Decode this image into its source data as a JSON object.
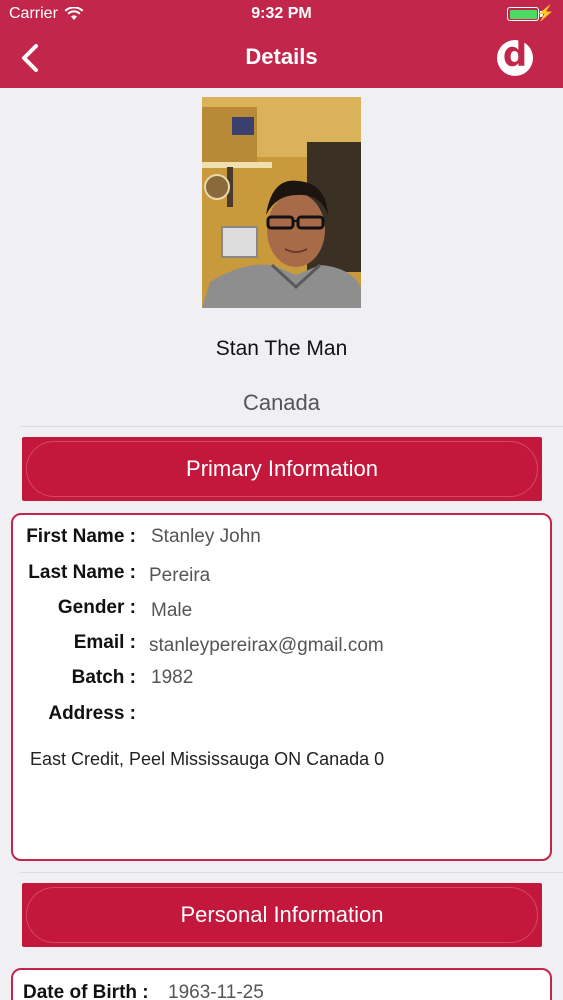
{
  "status_bar": {
    "carrier": "Carrier",
    "time": "9:32 PM",
    "battery_level": 1.0
  },
  "nav": {
    "title": "Details",
    "logo_letter": "d"
  },
  "profile": {
    "name": "Stan The Man",
    "country": "Canada"
  },
  "primary": {
    "header": "Primary Information",
    "first_name_label": "First Name :",
    "first_name": "Stanley John",
    "last_name_label": "Last Name :",
    "last_name": "Pereira",
    "gender_label": "Gender :",
    "gender": "Male",
    "email_label": "Email :",
    "email": "stanleypereirax@gmail.com",
    "batch_label": "Batch :",
    "batch": "1982",
    "address_label": "Address :",
    "address": "East Credit, Peel Mississauga ON Canada 0"
  },
  "personal": {
    "header": "Personal Information",
    "dob_label": "Date of Birth :",
    "dob": "1963-11-25"
  },
  "colors": {
    "brand": "#c3264b",
    "section": "#c3173c",
    "background": "#efeff4"
  }
}
